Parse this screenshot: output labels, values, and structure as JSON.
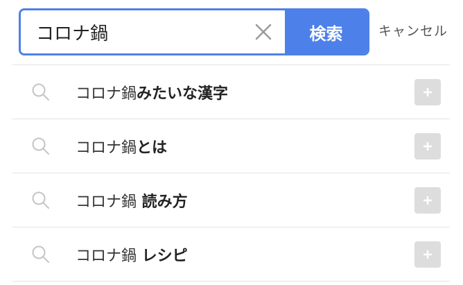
{
  "search": {
    "value": "コロナ鍋",
    "placeholder": "",
    "button_label": "検索"
  },
  "cancel_label": "キャンセル",
  "suggestions": [
    {
      "prefix": "コロナ鍋",
      "suffix": "みたいな漢字"
    },
    {
      "prefix": "コロナ鍋",
      "suffix": "とは"
    },
    {
      "prefix": "コロナ鍋",
      "suffix": " 読み方"
    },
    {
      "prefix": "コロナ鍋",
      "suffix": " レシピ"
    }
  ],
  "colors": {
    "accent": "#4d80e9",
    "plus_button": "#dddddd",
    "divider": "#e3e3e3"
  },
  "icons": {
    "clear": "close-icon",
    "suggestion": "search-icon",
    "append": "plus-icon"
  }
}
